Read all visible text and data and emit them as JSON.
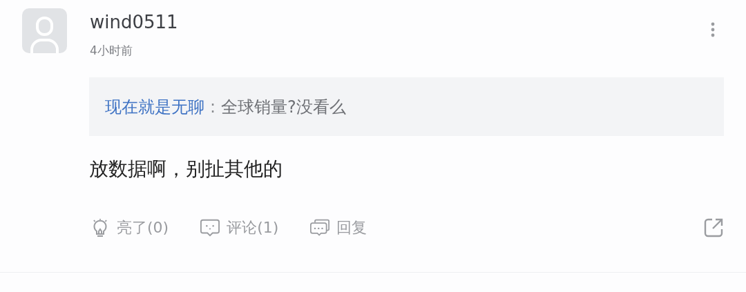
{
  "post": {
    "username": "wind0511",
    "time": "4小时前",
    "quote": {
      "author": "现在就是无聊",
      "separator": ":",
      "text": "全球销量?没看么"
    },
    "content": "放数据啊，别扯其他的",
    "actions": [
      {
        "kind": "light",
        "label": "亮了(0)"
      },
      {
        "kind": "comment",
        "label": "评论(1)"
      },
      {
        "kind": "reply",
        "label": "回复"
      }
    ]
  }
}
